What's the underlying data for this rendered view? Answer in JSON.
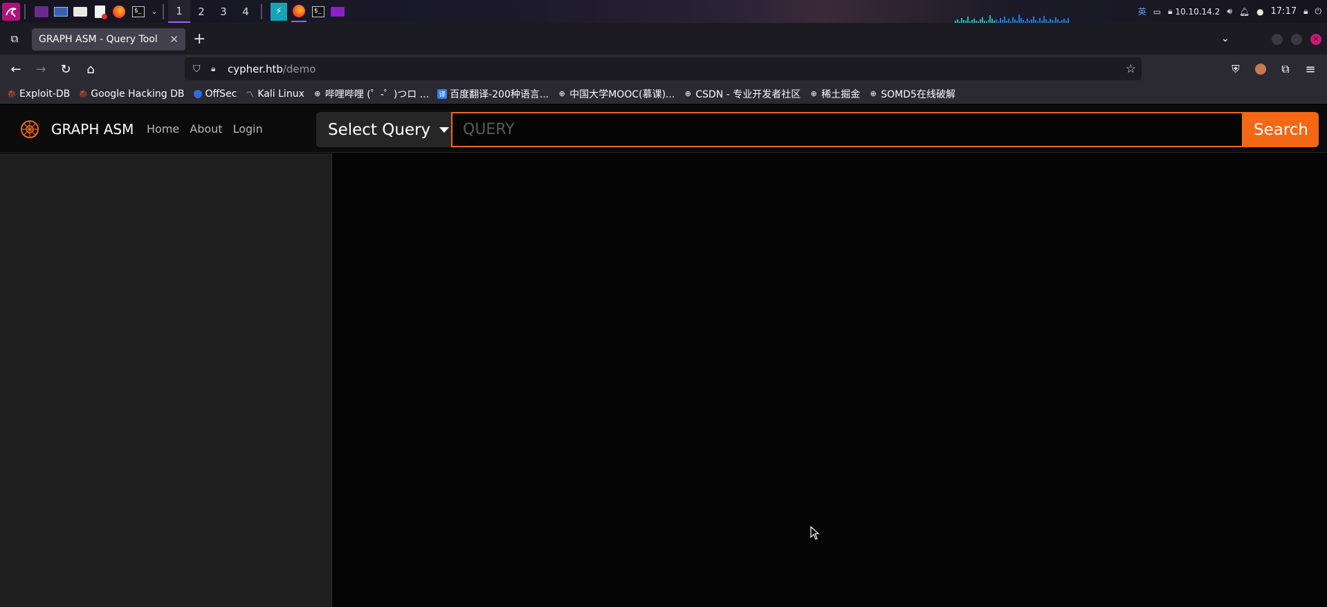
{
  "taskbar": {
    "workspaces": [
      "1",
      "2",
      "3",
      "4"
    ],
    "ip_address": "10.10.14.2",
    "input_method": "英",
    "clock": "17:17"
  },
  "browser": {
    "tab_title": "GRAPH ASM - Query Tool",
    "url_host": "cypher.htb",
    "url_path": "/demo",
    "bookmarks": [
      {
        "label": "Exploit-DB",
        "icon": "exploitdb-icon"
      },
      {
        "label": "Google Hacking DB",
        "icon": "ghdb-icon"
      },
      {
        "label": "OffSec",
        "icon": "offsec-icon"
      },
      {
        "label": "Kali Linux",
        "icon": "kali-icon"
      },
      {
        "label": "哔哩哔哩 (゜-゜)つロ ...",
        "icon": "globe-icon"
      },
      {
        "label": "百度翻译-200种语言...",
        "icon": "baidu-translate-icon"
      },
      {
        "label": "中国大学MOOC(慕课)...",
        "icon": "globe-icon"
      },
      {
        "label": "CSDN - 专业开发者社区",
        "icon": "globe-icon"
      },
      {
        "label": "稀土掘金",
        "icon": "globe-icon"
      },
      {
        "label": "SOMD5在线破解",
        "icon": "globe-icon"
      }
    ]
  },
  "site": {
    "brand": "GRAPH ASM",
    "nav": [
      "Home",
      "About",
      "Login"
    ],
    "select_query_label": "Select Query",
    "query_placeholder": "QUERY",
    "search_label": "Search",
    "accent_color": "#f46715"
  }
}
